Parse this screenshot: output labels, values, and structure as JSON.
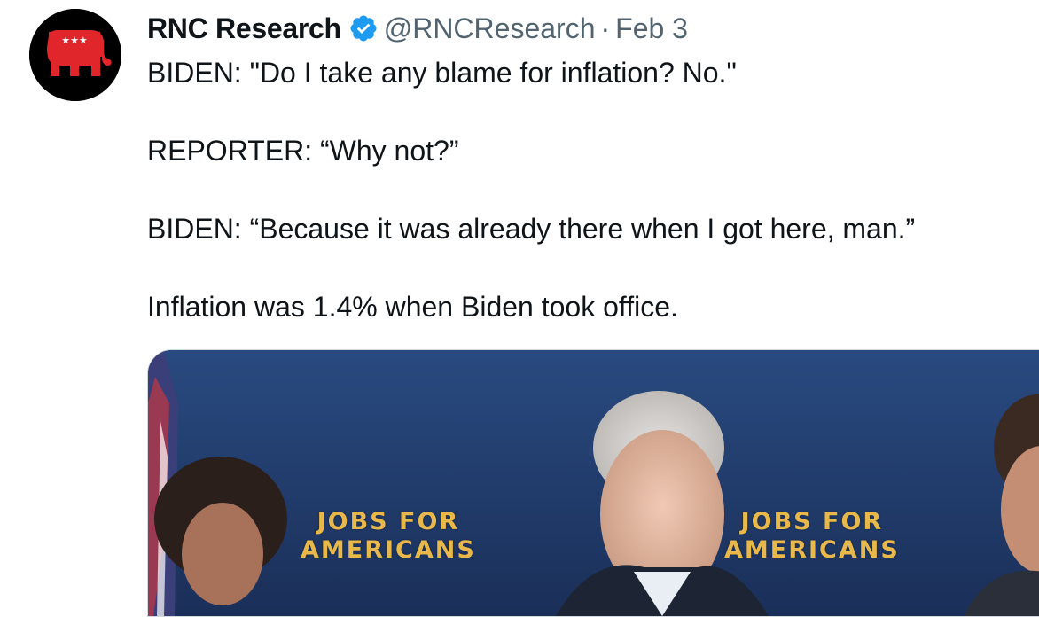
{
  "tweet": {
    "author_name": "RNC Research",
    "handle": "@RNCResearch",
    "separator": "·",
    "date": "Feb 3",
    "avatar_icon": "rnc-elephant-logo",
    "verified_icon": "verified-badge-icon",
    "paragraphs": [
      "BIDEN: \"Do I take any blame for inflation? No.\"",
      "REPORTER: “Why not?”",
      "BIDEN: “Because it was already there when I got here, man.”",
      "Inflation was 1.4% when Biden took office."
    ]
  },
  "media": {
    "banners": [
      {
        "line1": "JOBS FOR",
        "line2": "AMERICANS"
      },
      {
        "line1": "JOBS FOR",
        "line2": "AMERICANS"
      }
    ]
  },
  "colors": {
    "text": "#0f1419",
    "secondary": "#536471",
    "verified": "#1d9bf0",
    "rnc_red": "#e0262b",
    "backdrop": "#1d3563",
    "banner_gold": "#e8b84a"
  }
}
